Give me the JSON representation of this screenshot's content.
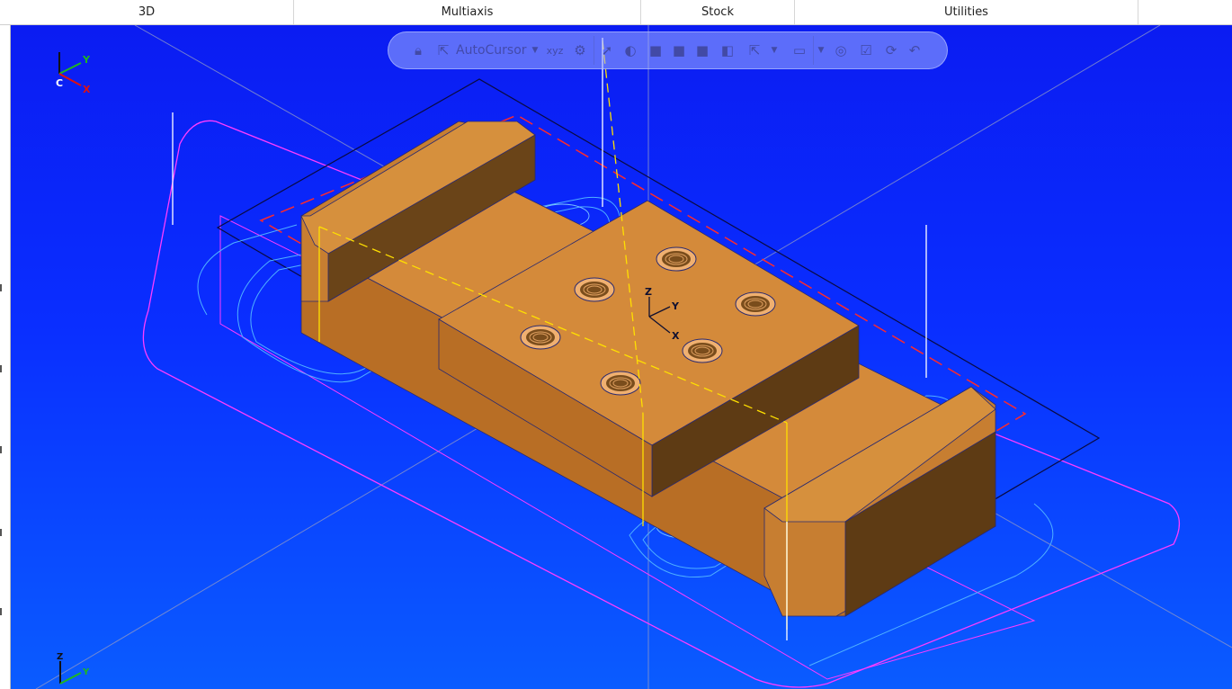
{
  "tabs": [
    {
      "label": "3D"
    },
    {
      "label": "Multiaxis"
    },
    {
      "label": "Stock"
    },
    {
      "label": "Utilities"
    }
  ],
  "toolbar": {
    "autocursor_label": "AutoCursor",
    "icons": [
      "lock-icon",
      "cursor-select-icon",
      "dropdown-chevron-icon",
      "xyz-icon",
      "point-gear-icon",
      "cursor-arrow-icon",
      "shade-icon",
      "view-cube-icon",
      "view-cube-icon",
      "view-cube-icon",
      "view-cube-icon",
      "select-arrow-icon",
      "dropdown-chevron-icon",
      "marquee-icon",
      "dropdown-chevron-icon",
      "highlight-icon",
      "select-check-icon",
      "select-rotate-icon",
      "undo-select-icon"
    ]
  },
  "axes": {
    "top_left": {
      "x": "X",
      "y": "Y",
      "c": "C"
    },
    "part": {
      "x": "X",
      "y": "Y",
      "z": "Z"
    },
    "bottom_left": {
      "z": "Z",
      "y": "Y"
    }
  },
  "colors": {
    "background_top": "#0b1cf2",
    "background_bottom": "#0a5cff",
    "part_face": "#d48a3a",
    "part_side": "#b86e25",
    "part_dark": "#5e3b14",
    "toolpath_blue": "#4fb0ff",
    "boundary_magenta": "#ff3cff",
    "dashed_red": "#ff2a2a",
    "dashed_yellow": "#ffe000"
  }
}
